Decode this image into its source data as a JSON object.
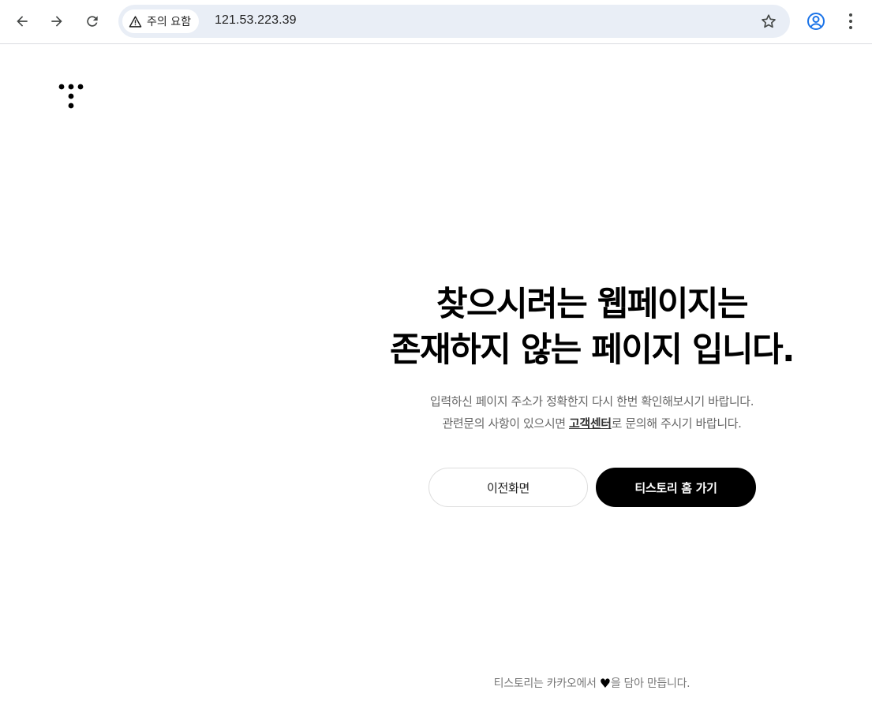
{
  "browser": {
    "security_label": "주의 요함",
    "url": "121.53.223.39",
    "icons": {
      "back": "arrow-left-icon",
      "forward": "arrow-right-icon",
      "reload": "reload-icon",
      "warning": "warning-triangle-icon",
      "bookmark": "star-icon",
      "profile": "profile-icon",
      "menu": "kebab-menu-icon"
    }
  },
  "page": {
    "heading_line1": "찾으시려는 웹페이지는",
    "heading_line2": "존재하지 않는 페이지 입니다.",
    "desc_line1": "입력하신 페이지 주소가 정확한지 다시 한번 확인해보시기 바랍니다.",
    "desc_line2_before": "관련문의 사항이 있으시면 ",
    "desc_link": "고객센터",
    "desc_line2_after": "로 문의해 주시기 바랍니다.",
    "prev_button": "이전화면",
    "home_button": "티스토리 홈 가기",
    "footer_before": "티스토리는 카카오에서 ",
    "footer_heart": "♥",
    "footer_after": "을 담아 만듭니다."
  },
  "colors": {
    "accent": "#000000",
    "profile_icon": "#1a73e8",
    "omnibox_bg": "#e9eef6"
  }
}
